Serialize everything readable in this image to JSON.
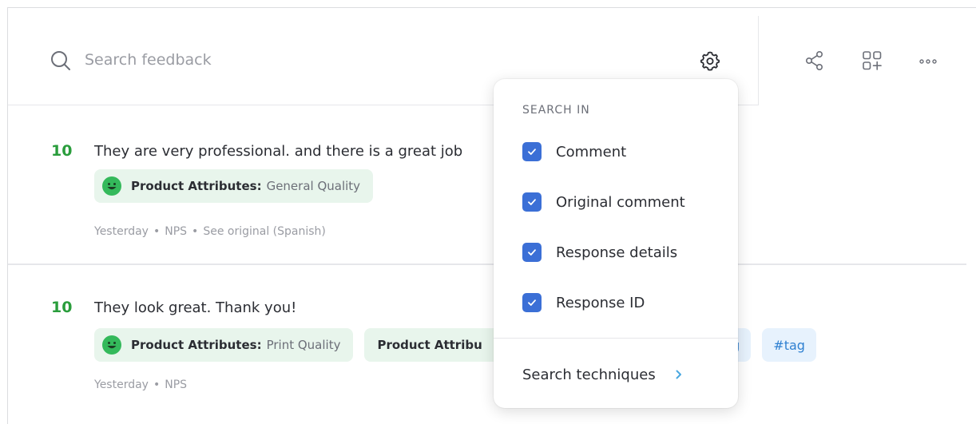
{
  "search": {
    "placeholder": "Search feedback"
  },
  "items": [
    {
      "score": "10",
      "comment": "They are very professional. and there is a great job",
      "tags": [
        {
          "label": "Product Attributes:",
          "value": "General Quality"
        }
      ],
      "meta": {
        "time": "Yesterday",
        "type": "NPS",
        "link": "See original (Spanish)"
      }
    },
    {
      "score": "10",
      "comment": "They look great. Thank you!",
      "tags": [
        {
          "label": "Product Attributes:",
          "value": "Print Quality"
        },
        {
          "label": "Product Attribu"
        }
      ],
      "hashtags": [
        "ng",
        "#tag"
      ],
      "meta": {
        "time": "Yesterday",
        "type": "NPS"
      }
    }
  ],
  "dropdown": {
    "title": "SEARCH IN",
    "options": [
      {
        "label": "Comment",
        "checked": true
      },
      {
        "label": "Original comment",
        "checked": true
      },
      {
        "label": "Response details",
        "checked": true
      },
      {
        "label": "Response ID",
        "checked": true
      }
    ],
    "techniques": "Search techniques"
  },
  "icons": {
    "search": "search-icon",
    "settings": "gear-icon",
    "share": "share-icon",
    "add_widget": "grid-add-icon",
    "more": "more-dots-icon",
    "check": "check-icon",
    "chevron": "chevron-right-icon"
  },
  "colors": {
    "score": "#2a9d3c",
    "checkbox": "#3b6fd6",
    "tag_bg": "#e8f5ec",
    "hashtag_bg": "#e7f2fd",
    "hashtag_text": "#2f80d1",
    "chevron": "#4aa8e0"
  }
}
